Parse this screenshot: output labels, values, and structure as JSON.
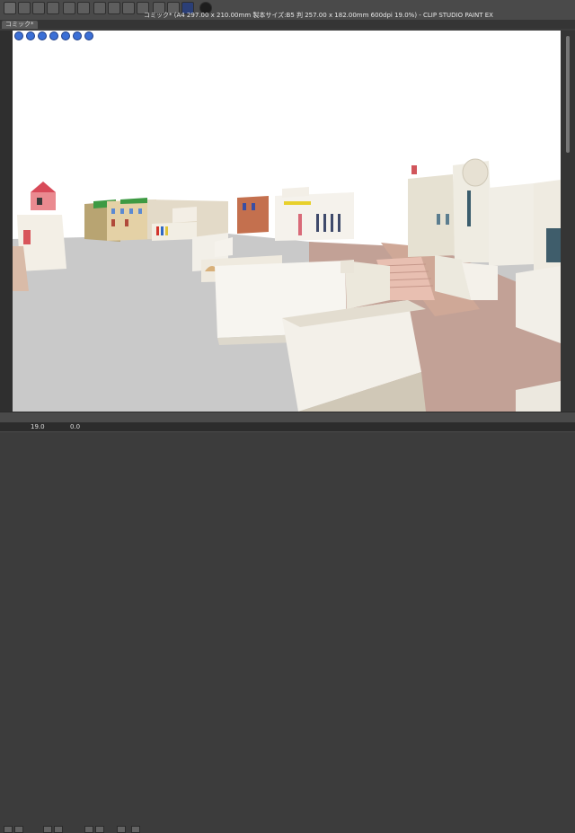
{
  "window": {
    "title": "コミック* (A4 297.00 x 210.00mm 製本サイズ:B5 判 257.00 x 182.00mm 600dpi 19.0%) - CLIP STUDIO PAINT EX"
  },
  "tabs": [
    {
      "label": "コミック*"
    }
  ],
  "status": {
    "zoom": "19.0",
    "angle": "0.0"
  },
  "colors": {
    "chrome": "#4a4a4a",
    "canvas": "#ffffff",
    "nav_blue": "#3b6fd6",
    "ground": "#c4c4c4",
    "path_brown": "#c3a094"
  },
  "icons": [
    "eye-icon",
    "undo-icon",
    "redo-icon",
    "move-icon",
    "zoom-icon",
    "navigator-icon",
    "help-icon",
    "layer-icon",
    "pen-icon"
  ]
}
